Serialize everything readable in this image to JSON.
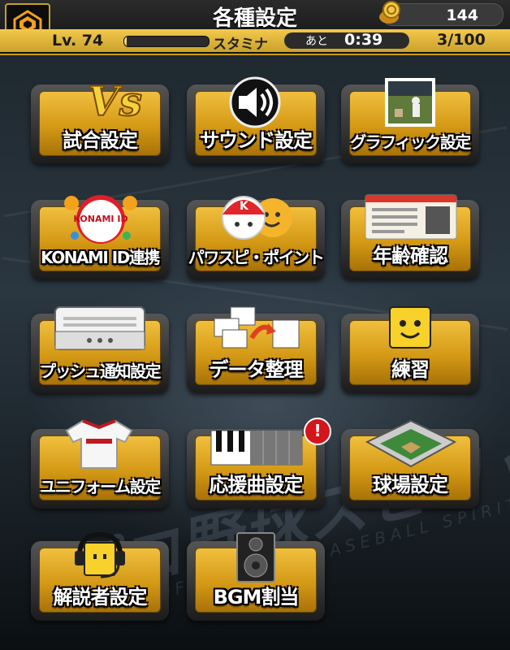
{
  "header": {
    "title": "各種設定",
    "coins": "144",
    "level_label": "Lv.",
    "level": "74",
    "stamina_label": "スタミナ",
    "stamina_fill_fraction": 0.03,
    "timer_prefix": "あと",
    "timer": "0:39",
    "stamina_count": "3/100"
  },
  "tiles": [
    {
      "label": "試合設定",
      "icon": "vs-icon"
    },
    {
      "label": "サウンド設定",
      "icon": "speaker-icon"
    },
    {
      "label": "グラフィック設定",
      "icon": "graphic-thumbnail-icon"
    },
    {
      "label": "KONAMI ID連携",
      "icon": "konami-id-icon",
      "icon_text": "KONAMI ID"
    },
    {
      "label": "パワスピ・ポイント",
      "icon": "pawa-mascot-icon"
    },
    {
      "label": "年齢確認",
      "icon": "id-card-icon"
    },
    {
      "label": "プッシュ通知設定",
      "icon": "push-device-icon"
    },
    {
      "label": "データ整理",
      "icon": "data-transfer-icon"
    },
    {
      "label": "練習",
      "icon": "smiley-block-icon"
    },
    {
      "label": "ユニフォーム設定",
      "icon": "uniform-icon"
    },
    {
      "label": "応援曲設定",
      "icon": "piano-icon",
      "badge": "!"
    },
    {
      "label": "球場設定",
      "icon": "stadium-icon"
    },
    {
      "label": "解説者設定",
      "icon": "headset-block-icon"
    },
    {
      "label": "BGM割当",
      "icon": "speaker-box-icon"
    }
  ],
  "colors": {
    "accent": "#d49915",
    "accent_light": "#f0bf3e",
    "badge": "#d4151b"
  }
}
